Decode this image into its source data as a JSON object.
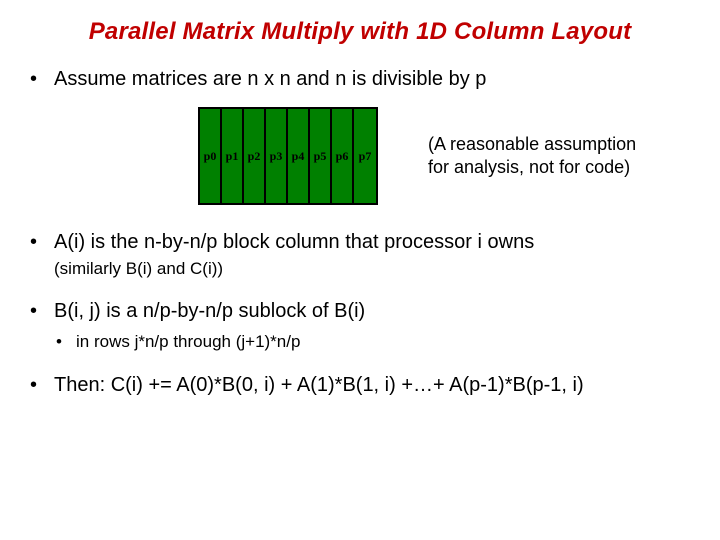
{
  "title": "Parallel Matrix Multiply with 1D Column Layout",
  "bullets": {
    "b0": "Assume matrices are n x n and n is divisible by p",
    "b1": "A(i) is the n-by-n/p block column that processor i owns",
    "b1sub": "(similarly B(i) and C(i))",
    "b2": "B(i, j) is a n/p-by-n/p sublock of B(i)",
    "b2sub": "in rows j*n/p through (j+1)*n/p",
    "b3": "Then:  C(i) += A(0)*B(0, i) + A(1)*B(1, i) +…+ A(p-1)*B(p-1, i)"
  },
  "matrix": {
    "cells": [
      "p0",
      "p1",
      "p2",
      "p3",
      "p4",
      "p5",
      "p6",
      "p7"
    ],
    "fill": "#008000"
  },
  "note": {
    "l1": "(A reasonable assumption",
    "l2": "for analysis, not for code)"
  }
}
